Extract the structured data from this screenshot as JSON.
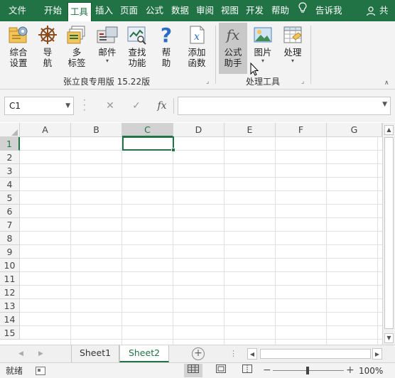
{
  "menu": {
    "tabs": [
      {
        "label": "文件",
        "active": false
      },
      {
        "label": "开始",
        "active": false
      },
      {
        "label": "工具",
        "active": true
      },
      {
        "label": "插入",
        "active": false
      },
      {
        "label": "页面",
        "active": false
      },
      {
        "label": "公式",
        "active": false
      },
      {
        "label": "数据",
        "active": false
      },
      {
        "label": "审阅",
        "active": false
      },
      {
        "label": "视图",
        "active": false
      },
      {
        "label": "开发",
        "active": false
      },
      {
        "label": "帮助",
        "active": false
      }
    ],
    "tell_me": "告诉我",
    "user": "共"
  },
  "ribbon": {
    "group1": {
      "label": "张立良专用版 15.22版",
      "buttons": [
        {
          "line1": "综合",
          "line2": "设置",
          "icon": "settings-box-icon"
        },
        {
          "line1": "导",
          "line2": "航",
          "icon": "ship-wheel-icon"
        },
        {
          "line1": "多",
          "line2": "标签",
          "icon": "multi-tab-icon"
        },
        {
          "line1": "邮件",
          "line2": "▾",
          "icon": "mail-icon"
        },
        {
          "line1": "查找",
          "line2": "功能",
          "icon": "find-function-icon"
        },
        {
          "line1": "帮",
          "line2": "助",
          "icon": "help-icon"
        },
        {
          "line1": "添加",
          "line2": "函数",
          "icon": "add-function-icon"
        }
      ]
    },
    "group2": {
      "label": "处理工具",
      "buttons": [
        {
          "line1": "公式",
          "line2": "助手",
          "icon": "fx-icon",
          "selected": true
        },
        {
          "line1": "图片",
          "line2": "▾",
          "icon": "picture-icon"
        },
        {
          "line1": "处理",
          "line2": "▾",
          "icon": "process-icon"
        }
      ]
    }
  },
  "formula_bar": {
    "name_box": "C1",
    "fx_label": "fx",
    "formula": ""
  },
  "grid": {
    "columns": [
      "A",
      "B",
      "C",
      "D",
      "E",
      "F",
      "G"
    ],
    "active_column": "C",
    "rows": [
      "1",
      "2",
      "3",
      "4",
      "5",
      "6",
      "7",
      "8",
      "9",
      "10",
      "11",
      "12",
      "13",
      "14",
      "15"
    ],
    "active_row": "1"
  },
  "sheets": {
    "tabs": [
      {
        "label": "Sheet1",
        "active": false
      },
      {
        "label": "Sheet2",
        "active": true
      }
    ],
    "overflow": "⋮"
  },
  "status": {
    "text": "就绪",
    "zoom": "100%"
  },
  "colors": {
    "brand": "#217346",
    "ribbon_bg": "#f3f3f3",
    "gridline": "#e1e1e1"
  }
}
